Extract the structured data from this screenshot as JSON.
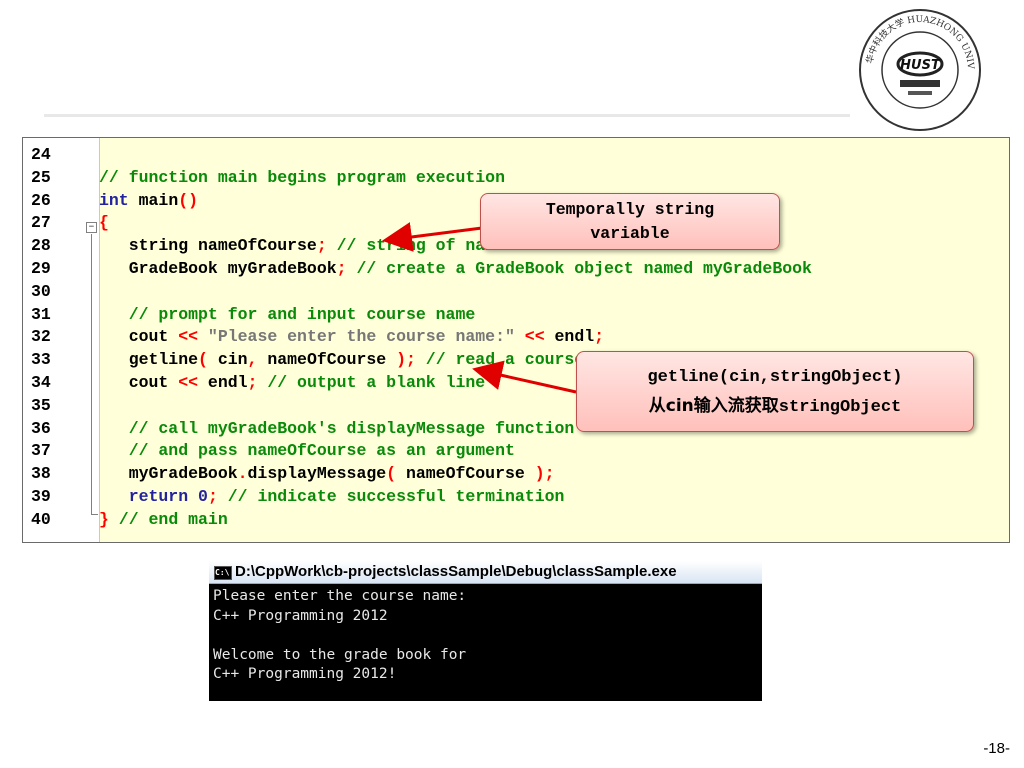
{
  "logo": {
    "text": "华中科技大学 HUAZHONG UNIVERSITY OF SCIENCE AND TECHNOLOGY",
    "monogram": "HUST"
  },
  "editor": {
    "lines": [
      {
        "n": "24",
        "segs": []
      },
      {
        "n": "25",
        "segs": [
          {
            "c": "c",
            "t": "// function main begins program execution"
          }
        ]
      },
      {
        "n": "26",
        "segs": [
          {
            "c": "k",
            "t": "int"
          },
          {
            "c": "d",
            "t": " main"
          },
          {
            "c": "p",
            "t": "()"
          }
        ]
      },
      {
        "n": "27",
        "segs": [
          {
            "c": "p",
            "t": "{"
          }
        ]
      },
      {
        "n": "28",
        "segs": [
          {
            "c": "d",
            "t": "   string nameOfCourse"
          },
          {
            "c": "p",
            "t": ";"
          },
          {
            "c": "c",
            "t": " // string of name to store the course name"
          }
        ]
      },
      {
        "n": "29",
        "segs": [
          {
            "c": "d",
            "t": "   GradeBook myGradeBook"
          },
          {
            "c": "p",
            "t": ";"
          },
          {
            "c": "c",
            "t": " // create a GradeBook object named myGradeBook"
          }
        ]
      },
      {
        "n": "30",
        "segs": []
      },
      {
        "n": "31",
        "segs": [
          {
            "c": "c",
            "t": "   // prompt for and input course name"
          }
        ]
      },
      {
        "n": "32",
        "segs": [
          {
            "c": "d",
            "t": "   cout "
          },
          {
            "c": "p",
            "t": "<<"
          },
          {
            "c": "s",
            "t": " \"Please enter the course name:\" "
          },
          {
            "c": "p",
            "t": "<<"
          },
          {
            "c": "d",
            "t": " endl"
          },
          {
            "c": "p",
            "t": ";"
          }
        ]
      },
      {
        "n": "33",
        "segs": [
          {
            "c": "d",
            "t": "   getline"
          },
          {
            "c": "p",
            "t": "("
          },
          {
            "c": "d",
            "t": " cin"
          },
          {
            "c": "p",
            "t": ","
          },
          {
            "c": "d",
            "t": " nameOfCourse "
          },
          {
            "c": "p",
            "t": ");"
          },
          {
            "c": "c",
            "t": " // read a course name"
          }
        ]
      },
      {
        "n": "34",
        "segs": [
          {
            "c": "d",
            "t": "   cout "
          },
          {
            "c": "p",
            "t": "<<"
          },
          {
            "c": "d",
            "t": " endl"
          },
          {
            "c": "p",
            "t": ";"
          },
          {
            "c": "c",
            "t": " // output a blank line"
          }
        ]
      },
      {
        "n": "35",
        "segs": []
      },
      {
        "n": "36",
        "segs": [
          {
            "c": "c",
            "t": "   // call myGradeBook's displayMessage function"
          }
        ]
      },
      {
        "n": "37",
        "segs": [
          {
            "c": "c",
            "t": "   // and pass nameOfCourse as an argument"
          }
        ]
      },
      {
        "n": "38",
        "segs": [
          {
            "c": "d",
            "t": "   myGradeBook"
          },
          {
            "c": "p",
            "t": "."
          },
          {
            "c": "d",
            "t": "displayMessage"
          },
          {
            "c": "p",
            "t": "("
          },
          {
            "c": "d",
            "t": " nameOfCourse "
          },
          {
            "c": "p",
            "t": ");"
          }
        ]
      },
      {
        "n": "39",
        "segs": [
          {
            "c": "k",
            "t": "   return"
          },
          {
            "c": "d",
            "t": " "
          },
          {
            "c": "k",
            "t": "0"
          },
          {
            "c": "p",
            "t": ";"
          },
          {
            "c": "c",
            "t": " // indicate successful termination"
          }
        ]
      },
      {
        "n": "40",
        "segs": [
          {
            "c": "p",
            "t": "}"
          },
          {
            "c": "c",
            "t": " // end main"
          }
        ]
      }
    ]
  },
  "callouts": {
    "first_line1": "Temporally string",
    "first_line2": "variable",
    "second_line1": "getline(cin,stringObject)",
    "second_prefix": "从cin输入流获取",
    "second_suffix": "stringObject"
  },
  "console": {
    "title": "D:\\CppWork\\cb-projects\\classSample\\Debug\\classSample.exe",
    "icon_text": "C:\\",
    "output": "Please enter the course name:\nC++ Programming 2012\n\nWelcome to the grade book for\nC++ Programming 2012!"
  },
  "page_number": "-18-"
}
